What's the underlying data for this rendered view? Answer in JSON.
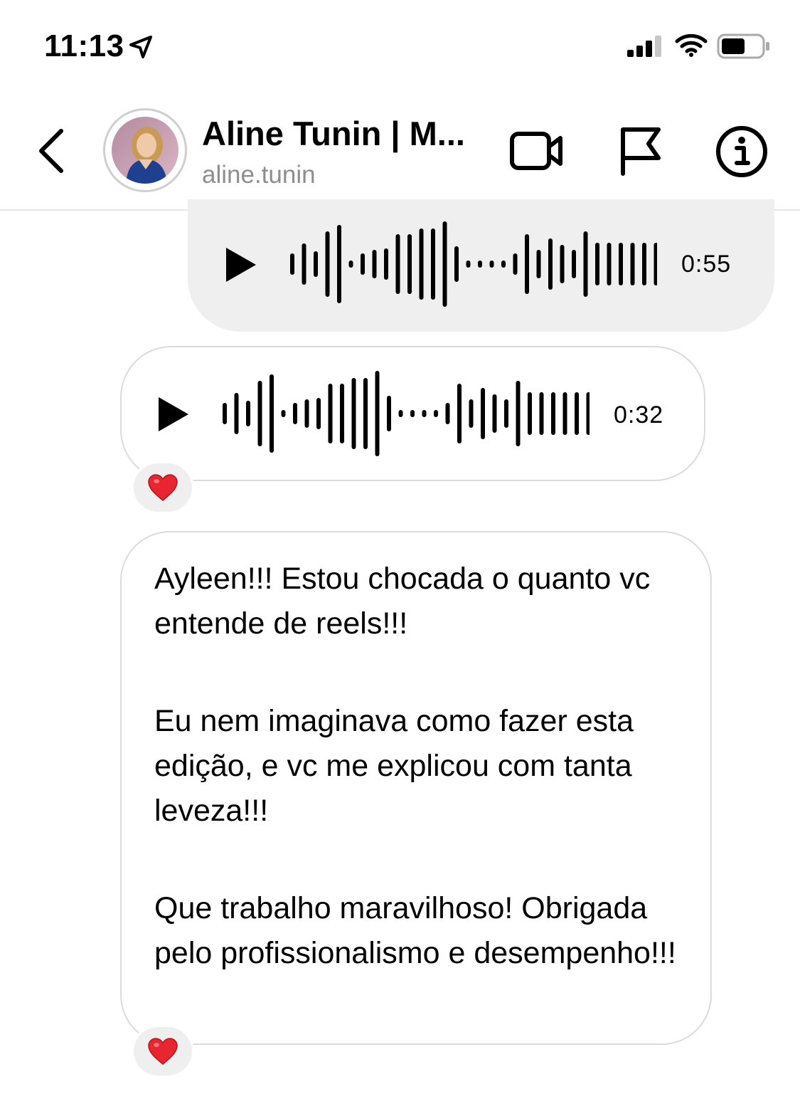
{
  "status_bar": {
    "time": "11:13",
    "icons": [
      "location-arrow-icon",
      "cellular-signal-icon",
      "wifi-icon",
      "battery-icon"
    ]
  },
  "header": {
    "contact_name": "Aline Tunin | M...",
    "contact_handle": "aline.tunin",
    "icons": [
      "back-chevron-icon",
      "video-call-icon",
      "flag-icon",
      "info-icon"
    ]
  },
  "messages": [
    {
      "direction": "sent",
      "type": "audio",
      "duration": "0:55"
    },
    {
      "direction": "received",
      "type": "audio",
      "duration": "0:32",
      "reaction": "❤️"
    },
    {
      "direction": "received",
      "type": "text",
      "paragraphs": [
        "Ayleen!!! Estou chocada o quanto vc entende de reels!!!",
        "Eu nem imaginava como fazer esta edição, e vc me explicou com tanta leveza!!!",
        "Que trabalho maravilhoso! Obrigada pelo profissionalismo e desempenho!!!"
      ],
      "reaction": "❤️"
    }
  ],
  "colors": {
    "sent_bubble": "#efefef",
    "received_border": "#dbdbdb",
    "handle_text": "#8e8e8e",
    "reaction_heart": "#e8262f"
  }
}
